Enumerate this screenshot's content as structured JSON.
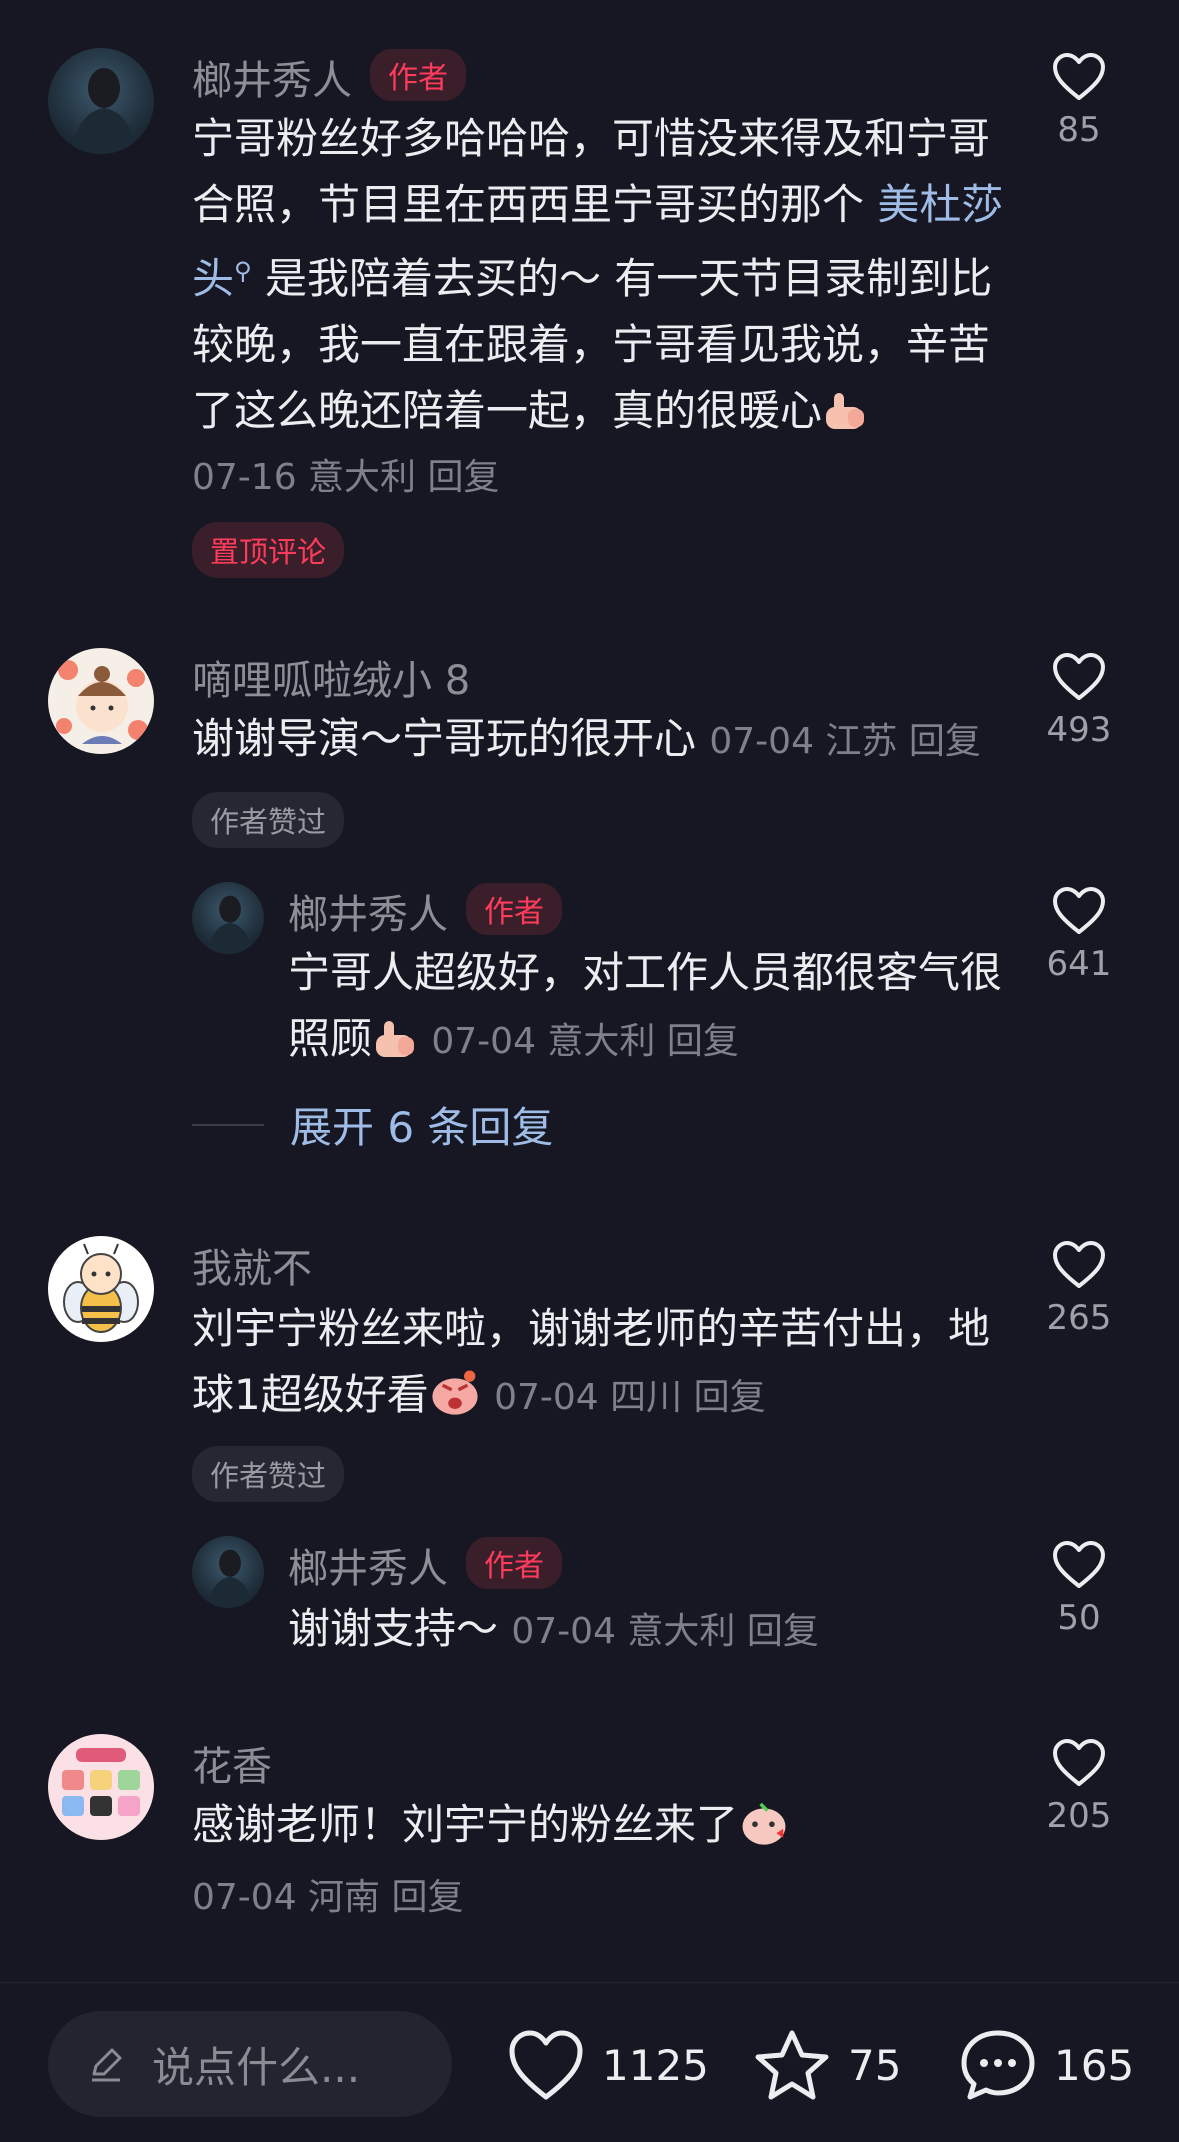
{
  "colors": {
    "background": "#161722",
    "author_badge": "#ff3b5c",
    "link": "#9fbce6"
  },
  "comments": [
    {
      "username": "榔井秀人",
      "badge": "作者",
      "text_before": "宁哥粉丝好多哈哈哈，可惜没来得及和宁哥合照，节目里在西西里宁哥买的那个 ",
      "link": "美杜莎头",
      "text_after": " 是我陪着去买的～ 有一天节目录制到比较晚，我一直在跟着，宁哥看见我说，辛苦了这么晚还陪着一起，真的很暖心",
      "meta": "07-16 意大利 回复",
      "tag": "置顶评论",
      "likes": "85"
    },
    {
      "username": "嘀哩呱啦绒小 8",
      "text": "谢谢导演～宁哥玩的很开心",
      "meta": "07-04 江苏 回复",
      "tag": "作者赞过",
      "likes": "493",
      "reply": {
        "username": "榔井秀人",
        "badge": "作者",
        "text": "宁哥人超级好，对工作人员都很客气很照顾",
        "meta": "07-04 意大利 回复",
        "likes": "641"
      },
      "expand_label": "展开 6 条回复"
    },
    {
      "username": "我就不",
      "text": "刘宇宁粉丝来啦，谢谢老师的辛苦付出，地球1超级好看",
      "meta": "07-04 四川 回复",
      "tag": "作者赞过",
      "likes": "265",
      "reply": {
        "username": "榔井秀人",
        "badge": "作者",
        "text": "谢谢支持～",
        "meta": "07-04 意大利 回复",
        "likes": "50"
      }
    },
    {
      "username": "花香",
      "text": "感谢老师！刘宇宁的粉丝来了",
      "meta": "07-04 河南 回复",
      "likes": "205"
    }
  ],
  "bottom_bar": {
    "placeholder": "说点什么...",
    "likes": "1125",
    "favorites": "75",
    "comments": "165"
  }
}
